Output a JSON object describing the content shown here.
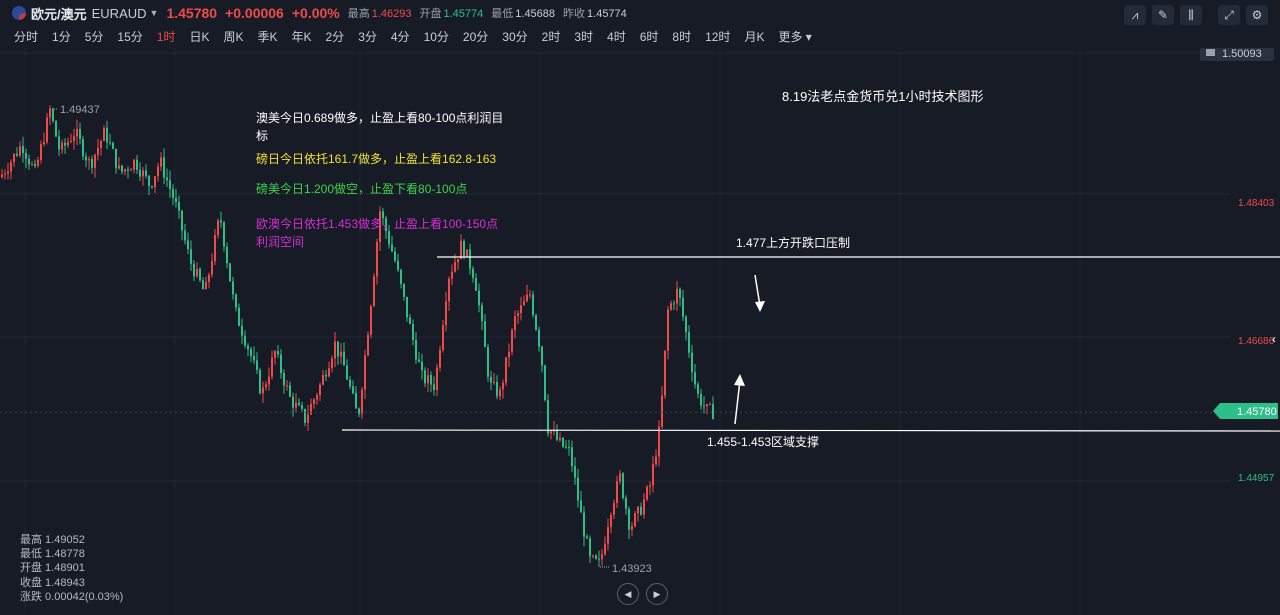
{
  "header": {
    "symbol_name": "欧元/澳元",
    "symbol_code": "EURAUD",
    "last_price": "1.45780",
    "change": "+0.00006",
    "change_pct": "+0.00%",
    "stats": [
      {
        "label": "最高",
        "value": "1.46293",
        "color": "red"
      },
      {
        "label": "开盘",
        "value": "1.45774",
        "color": "green"
      },
      {
        "label": "最低",
        "value": "1.45688",
        "color": "plain"
      },
      {
        "label": "昨收",
        "value": "1.45774",
        "color": "plain"
      }
    ]
  },
  "timeframes": [
    "分时",
    "1分",
    "5分",
    "15分",
    "1时",
    "日K",
    "周K",
    "季K",
    "年K",
    "2分",
    "3分",
    "4分",
    "10分",
    "20分",
    "30分",
    "2时",
    "3时",
    "4时",
    "6时",
    "8时",
    "12时",
    "月K",
    "更多"
  ],
  "active_timeframe": "1时",
  "toolbar_icons": [
    "indicator-icon",
    "draw-pen-icon",
    "candle-type-icon",
    "fullscreen-icon",
    "settings-icon"
  ],
  "chart": {
    "price_axis_labels": [
      {
        "value": "1.50093",
        "color": "#c9ced8"
      },
      {
        "value": "1.48403",
        "color": "#f04a4a"
      },
      {
        "value": "1.46686",
        "color": "#f04a4a"
      },
      {
        "value": "1.44957",
        "color": "#2dbf8a"
      }
    ],
    "current_price_tag": "1.45780",
    "high_marker": "1.49437",
    "low_marker": "1.43923",
    "title": "8.19法老点金货币兑1小时技术图形",
    "notes": [
      {
        "text": "澳美今日0.689做多，止盈上看80-100点利润目",
        "color": "#ffffff"
      },
      {
        "text": "标",
        "color": "#ffffff"
      },
      {
        "text": "磅日今日依托161.7做多，止盈上看162.8-163",
        "color": "#f2e233"
      },
      {
        "text": "磅美今日1.200做空，止盈下看80-100点",
        "color": "#3fd14a"
      },
      {
        "text": "欧澳今日依托1.453做多，止盈上看100-150点",
        "color": "#d42fd4"
      },
      {
        "text": "利润空间",
        "color": "#d42fd4"
      }
    ],
    "resistance_label": "1.477上方开跌口压制",
    "support_label": "1.455-1.453区域支撑"
  },
  "ohlc": {
    "high": "最高 1.49052",
    "low": "最低 1.48778",
    "open": "开盘 1.48901",
    "close": "收盘 1.48943",
    "change": "涨跌 0.00042(0.03%)"
  },
  "colors": {
    "up": "#f04a4a",
    "down": "#2dbf8a",
    "background": "#161b26"
  }
}
